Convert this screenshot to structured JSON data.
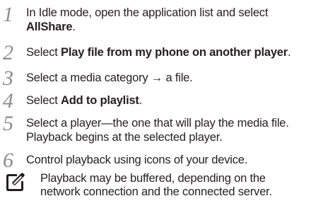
{
  "steps": [
    {
      "number": "1",
      "lines": [
        [
          {
            "text": "In Idle mode, open the application list and select",
            "bold": false
          }
        ],
        [
          {
            "text": "AllShare",
            "bold": true
          },
          {
            "text": ".",
            "bold": false
          }
        ]
      ]
    },
    {
      "number": "2",
      "lines": [
        [
          {
            "text": "Select ",
            "bold": false
          },
          {
            "text": "Play file from my phone on another player",
            "bold": true
          },
          {
            "text": ".",
            "bold": false
          }
        ]
      ]
    },
    {
      "number": "3",
      "lines": [
        [
          {
            "text": "Select a media category → a file.",
            "bold": false
          }
        ]
      ]
    },
    {
      "number": "4",
      "lines": [
        [
          {
            "text": "Select ",
            "bold": false
          },
          {
            "text": "Add to playlist",
            "bold": true
          },
          {
            "text": ".",
            "bold": false
          }
        ]
      ]
    },
    {
      "number": "5",
      "lines": [
        [
          {
            "text": "Select a player—the one that will play the media file.",
            "bold": false
          }
        ],
        [
          {
            "text": "Playback begins at the selected player.",
            "bold": false
          }
        ]
      ]
    },
    {
      "number": "6",
      "lines": [
        [
          {
            "text": "Control playback using icons of your device.",
            "bold": false
          }
        ]
      ]
    }
  ],
  "note": {
    "icon": "note-pencil-icon",
    "lines": [
      "Playback may be buffered, depending on the",
      "network connection and the connected server."
    ]
  },
  "colors": {
    "text": "#231f20",
    "step_number": "#8c8c8c",
    "icon": "#231f20"
  }
}
